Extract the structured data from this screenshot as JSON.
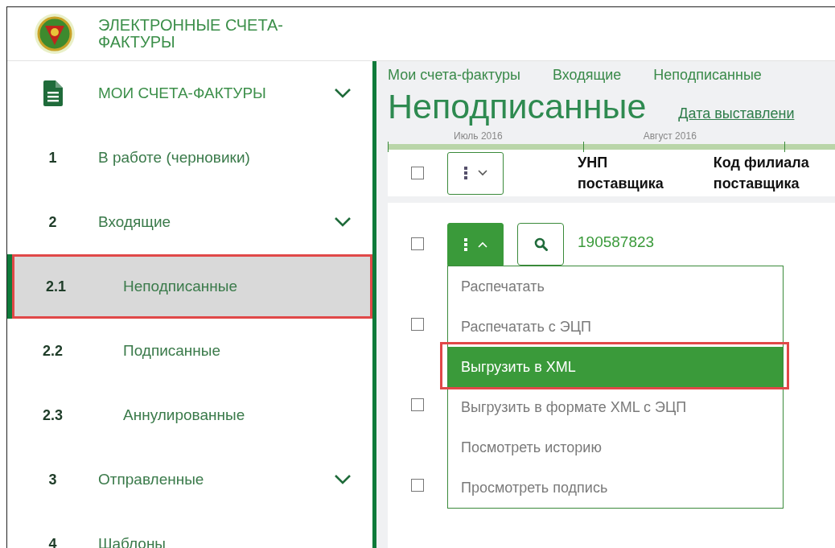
{
  "header": {
    "title": "ЭЛЕКТРОННЫЕ СЧЕТА-ФАКТУРЫ"
  },
  "sidebar": {
    "items": [
      {
        "kind": "section",
        "label": "МОИ СЧЕТА-ФАКТУРЫ",
        "selected": false
      },
      {
        "kind": "link",
        "number": "1",
        "label": "В работе (черновики)",
        "selected": false
      },
      {
        "kind": "group",
        "number": "2",
        "label": "Входящие",
        "selected": false,
        "children": [
          {
            "number": "2.1",
            "label": "Неподписанные",
            "selected": true,
            "highlighted": true
          },
          {
            "number": "2.2",
            "label": "Подписанные",
            "selected": false,
            "highlighted": false
          },
          {
            "number": "2.3",
            "label": "Аннулированные",
            "selected": false,
            "highlighted": false
          }
        ]
      },
      {
        "kind": "group",
        "number": "3",
        "label": "Отправленные",
        "selected": false
      },
      {
        "kind": "link",
        "number": "4",
        "label": "Шаблоны",
        "selected": false
      }
    ]
  },
  "main": {
    "breadcrumbs": [
      "Мои счета-фактуры",
      "Входящие",
      "Неподписанные"
    ],
    "title": "Неподписанные",
    "sort_link": "Дата выставлени",
    "timeline": [
      "Июль 2016",
      "Август 2016"
    ],
    "table": {
      "header_checked": false,
      "columns": [
        "УНП поставщика",
        "Код филиала поставщика"
      ],
      "rows": [
        {
          "checked": false,
          "menu_open": true,
          "unp": "190587823"
        },
        {
          "checked": false
        },
        {
          "checked": false
        },
        {
          "checked": false
        }
      ],
      "menu": [
        {
          "label": "Распечатать",
          "selected": false,
          "highlighted": false
        },
        {
          "label": "Распечатать с ЭЦП",
          "selected": false,
          "highlighted": false
        },
        {
          "label": "Выгрузить в XML",
          "selected": true,
          "highlighted": true
        },
        {
          "label": "Выгрузить в формате XML с ЭЦП",
          "selected": false,
          "highlighted": false
        },
        {
          "label": "Посмотреть историю",
          "selected": false,
          "highlighted": false
        },
        {
          "label": "Просмотреть подпись",
          "selected": false,
          "highlighted": false
        }
      ]
    }
  }
}
